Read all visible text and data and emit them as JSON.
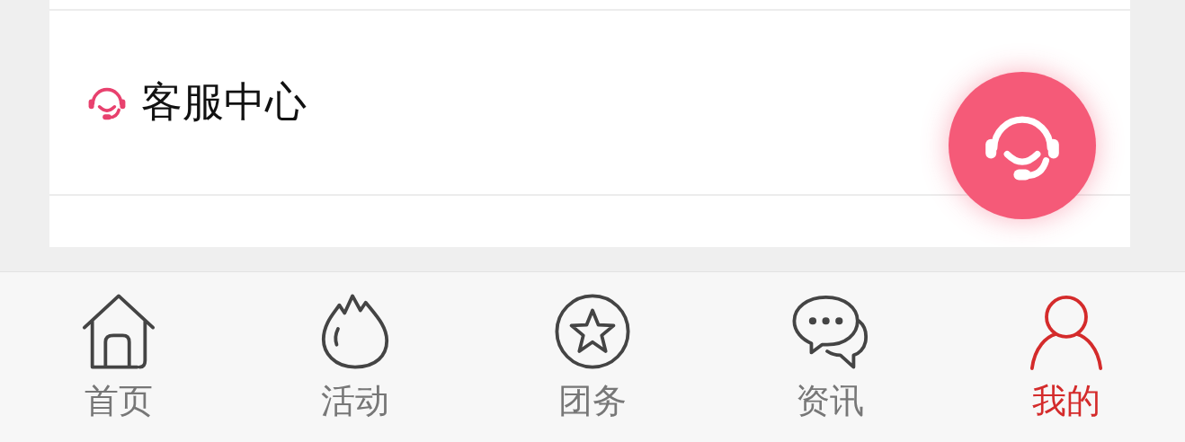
{
  "menu": [
    {
      "label": "客服中心"
    }
  ],
  "tabs": [
    {
      "label": "首页",
      "selected": false
    },
    {
      "label": "活动",
      "selected": false
    },
    {
      "label": "团务",
      "selected": false
    },
    {
      "label": "资讯",
      "selected": false
    },
    {
      "label": "我的",
      "selected": true
    }
  ]
}
